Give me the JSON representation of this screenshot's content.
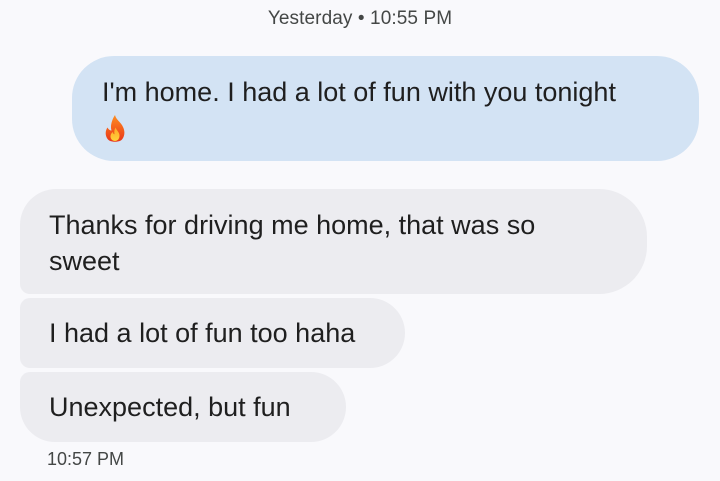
{
  "header": {
    "timestamp": "Yesterday • 10:55 PM"
  },
  "messages": [
    {
      "direction": "outgoing",
      "text": "I'm home. I had a lot of fun with you tonight",
      "emoji": "fire-icon"
    },
    {
      "direction": "incoming",
      "text": "Thanks for driving me home, that was so sweet"
    },
    {
      "direction": "incoming",
      "text": "I had a lot of fun too haha"
    },
    {
      "direction": "incoming",
      "text": "Unexpected, but fun"
    }
  ],
  "footer": {
    "timestamp": "10:57 PM"
  },
  "colors": {
    "background": "#f9f9fc",
    "outgoing_bubble": "#d3e3f4",
    "incoming_bubble": "#ececf0",
    "text": "#1f1f1f",
    "timestamp": "#444746"
  }
}
